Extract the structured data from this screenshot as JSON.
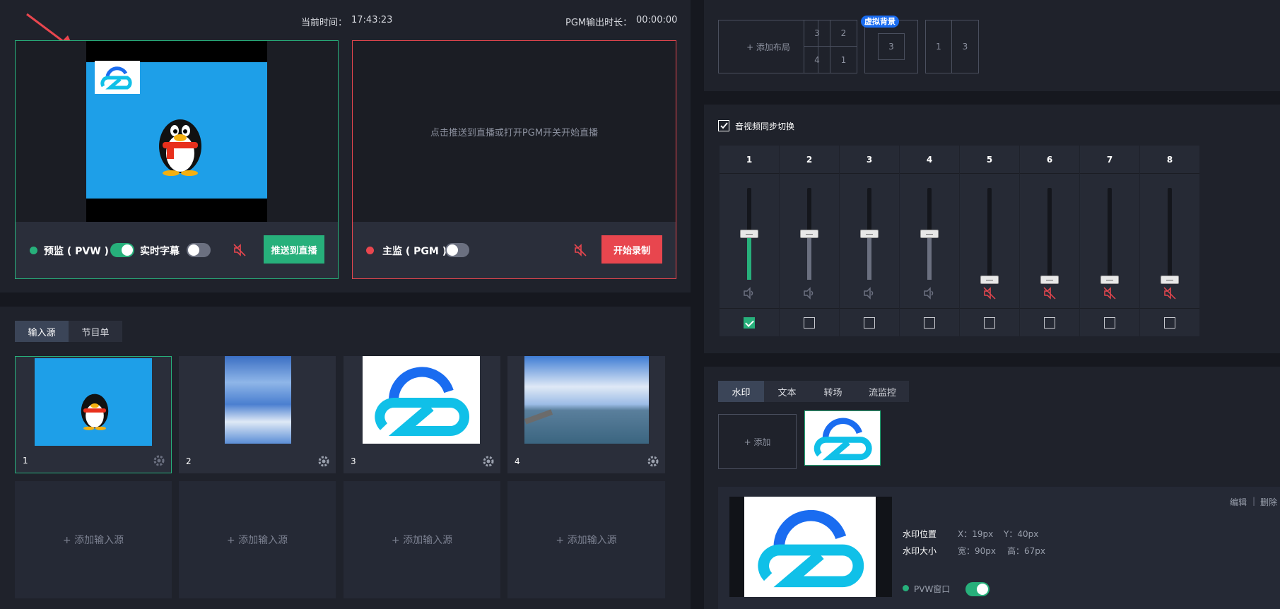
{
  "header": {
    "current_time_label": "当前时间：",
    "current_time": "17:43:23",
    "pgm_duration_label": "PGM输出时长：",
    "pgm_duration": "00:00:00"
  },
  "preview": {
    "label": "预监 ( PVW )",
    "subtitle_label": "实时字幕",
    "push_button": "推送到直播",
    "status_color": "#27b07b",
    "toggle_on": true,
    "subtitle_toggle_on": false
  },
  "program": {
    "label": "主监 ( PGM )",
    "placeholder": "点击推送到直播或打开PGM开关开始直播",
    "record_button": "开始录制",
    "status_color": "#e8464e",
    "toggle_on": false
  },
  "source_tabs": [
    "输入源",
    "节目单"
  ],
  "sources": [
    {
      "num": "1",
      "image": "penguin-on-blue",
      "selected": true
    },
    {
      "num": "2",
      "image": "blue-sky-clouds",
      "selected": false
    },
    {
      "num": "3",
      "image": "cloud-logo",
      "selected": false
    },
    {
      "num": "4",
      "image": "pier-seascape",
      "selected": false
    }
  ],
  "add_source_label": "+ 添加输入源",
  "layouts": {
    "add_layout_label": "+ 添加布局",
    "grid4": [
      "3",
      "2",
      "4",
      "1"
    ],
    "virtual_bg_badge": "虚拟背景",
    "virtual_bg_cell": "3",
    "split": [
      "1",
      "3"
    ]
  },
  "audio": {
    "sync_label": "音视频同步切换",
    "sync_checked": true,
    "channels": [
      {
        "id": "1",
        "level": 0.5,
        "muted": false,
        "checked": true,
        "active": true
      },
      {
        "id": "2",
        "level": 0.5,
        "muted": false,
        "checked": false,
        "active": false
      },
      {
        "id": "3",
        "level": 0.5,
        "muted": false,
        "checked": false,
        "active": false
      },
      {
        "id": "4",
        "level": 0.5,
        "muted": false,
        "checked": false,
        "active": false
      },
      {
        "id": "5",
        "level": 0.0,
        "muted": true,
        "checked": false,
        "active": false
      },
      {
        "id": "6",
        "level": 0.0,
        "muted": true,
        "checked": false,
        "active": false
      },
      {
        "id": "7",
        "level": 0.0,
        "muted": true,
        "checked": false,
        "active": false
      },
      {
        "id": "8",
        "level": 0.0,
        "muted": true,
        "checked": false,
        "active": false
      }
    ]
  },
  "watermark": {
    "tabs": [
      "水印",
      "文本",
      "转场",
      "流监控"
    ],
    "add_label": "+ 添加",
    "edit_label": "编辑",
    "separator": "|",
    "delete_label": "删除",
    "position_label": "水印位置",
    "pos_x": "X：19px",
    "pos_y": "Y：40px",
    "size_label": "水印大小",
    "width": "宽：90px",
    "height": "高：67px",
    "pvw_window_label": "PVW窗口",
    "pvw_toggle_on": true
  },
  "colors": {
    "accent_green": "#27b07b",
    "accent_red": "#e8464e",
    "preview_blue": "#1e9fe8"
  }
}
